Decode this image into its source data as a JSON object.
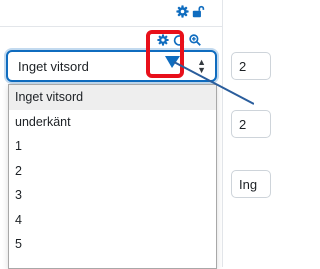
{
  "grading": {
    "selected_value": "Inget vitsord",
    "options": [
      "Inget vitsord",
      "underkänt",
      "1",
      "2",
      "3",
      "4",
      "5"
    ],
    "selected_index": 0
  },
  "side_fields": [
    "2",
    "2",
    "Ing"
  ],
  "icons": {
    "header": [
      "gear-icon",
      "unlock-icon"
    ],
    "toolbar": [
      "gear-icon",
      "refresh-icon",
      "zoom-in-icon"
    ]
  },
  "colors": {
    "accent": "#0f6cbf",
    "highlight": "#e8101a"
  }
}
